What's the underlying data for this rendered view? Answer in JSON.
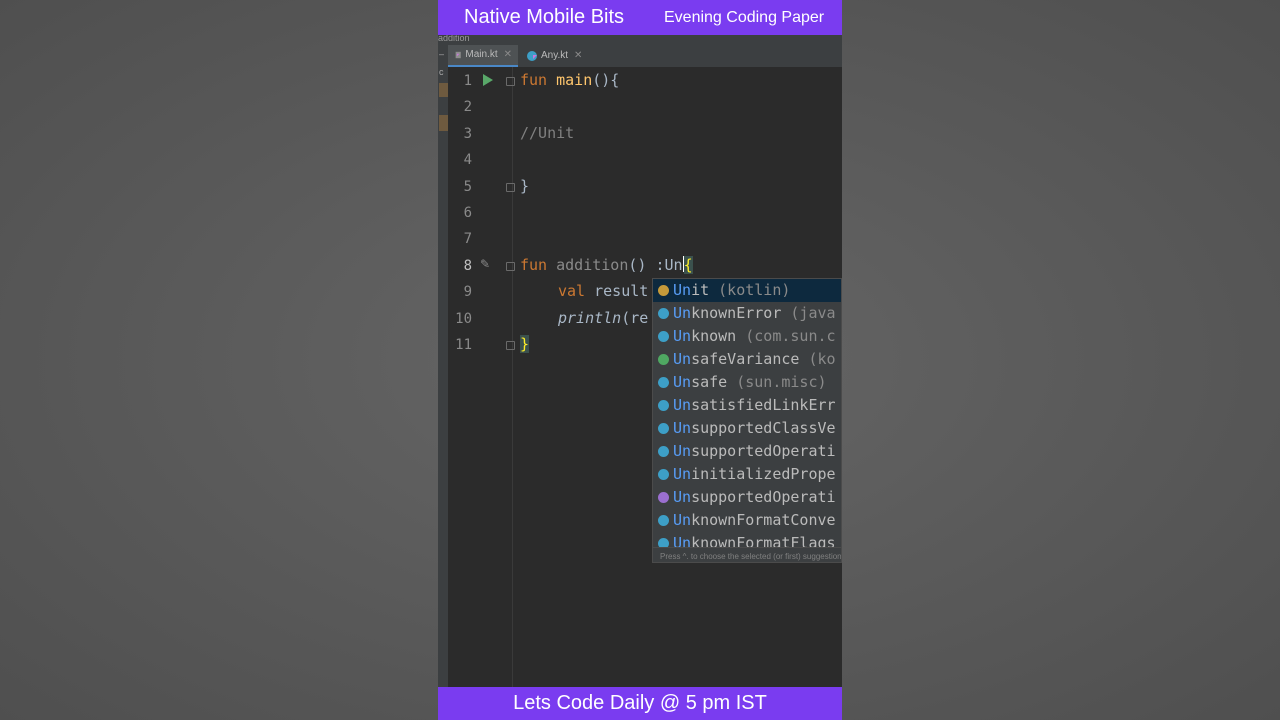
{
  "banner": {
    "title": "Native Mobile Bits",
    "subtitle": "Evening Coding Paper",
    "footer": "Lets Code Daily @ 5 pm IST",
    "color": "#7a3cf0"
  },
  "breadcrumb": {
    "text": "addition"
  },
  "tabs": [
    {
      "label": "Main.kt",
      "icon": "kotlin-file-icon",
      "active": true
    },
    {
      "label": "Any.kt",
      "icon": "kotlin-class-icon",
      "active": false
    }
  ],
  "editor": {
    "line_numbers": [
      "1",
      "2",
      "3",
      "4",
      "5",
      "6",
      "7",
      "8",
      "9",
      "10",
      "11"
    ],
    "lines": {
      "l1_kw": "fun",
      "l1_name": "main",
      "l1_rest": "(){",
      "l3_comment": "//Unit",
      "l5_brace": "}",
      "l8_kw": "fun",
      "l8_name": "addition",
      "l8_rest": "() :Un",
      "l8_brace": "{",
      "l9_kw": "val",
      "l9_rest": "result",
      "l10_call": "println",
      "l10_rest": "(re",
      "l11_brace": "}"
    }
  },
  "completion": {
    "items": [
      {
        "match": "Un",
        "rest": "it",
        "pkg": " (kotlin)",
        "icon_color": "#c59a3a",
        "selected": true
      },
      {
        "match": "Un",
        "rest": "knownError",
        "pkg": " (java",
        "icon_color": "#3d9fc7",
        "selected": false
      },
      {
        "match": "Un",
        "rest": "known",
        "pkg": " (com.sun.c",
        "icon_color": "#3d9fc7",
        "selected": false
      },
      {
        "match": "Un",
        "rest": "safeVariance",
        "pkg": " (ko",
        "icon_color": "#4fa862",
        "selected": false
      },
      {
        "match": "Un",
        "rest": "safe",
        "pkg": " (sun.misc)",
        "icon_color": "#3d9fc7",
        "selected": false
      },
      {
        "match": "Un",
        "rest": "satisfiedLinkErr",
        "pkg": "",
        "icon_color": "#3d9fc7",
        "selected": false
      },
      {
        "match": "Un",
        "rest": "supportedClassVe",
        "pkg": "",
        "icon_color": "#3d9fc7",
        "selected": false
      },
      {
        "match": "Un",
        "rest": "supportedOperati",
        "pkg": "",
        "icon_color": "#3d9fc7",
        "selected": false
      },
      {
        "match": "Un",
        "rest": "initializedPrope",
        "pkg": "",
        "icon_color": "#3d9fc7",
        "selected": false
      },
      {
        "match": "Un",
        "rest": "supportedOperati",
        "pkg": "",
        "icon_color": "#9b6fd0",
        "selected": false
      },
      {
        "match": "Un",
        "rest": "knownFormatConve",
        "pkg": "",
        "icon_color": "#3d9fc7",
        "selected": false
      },
      {
        "match": "Un",
        "rest": "knownFormatFlags",
        "pkg": "",
        "icon_color": "#3d9fc7",
        "selected": false
      }
    ],
    "hint": "Press ^. to choose the selected (or first) suggestion"
  }
}
